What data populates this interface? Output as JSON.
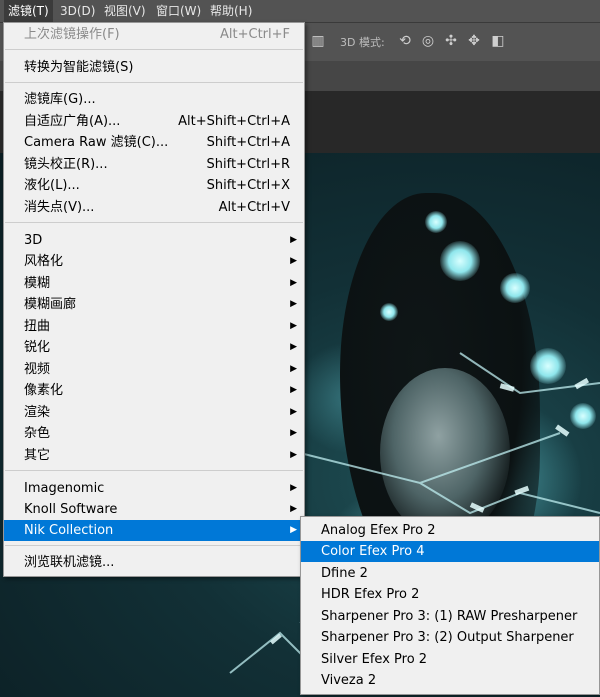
{
  "menubar": {
    "items": [
      {
        "label": "滤镜(T)",
        "active": true
      },
      {
        "label": "3D(D)",
        "active": false
      },
      {
        "label": "视图(V)",
        "active": false
      },
      {
        "label": "窗口(W)",
        "active": false
      },
      {
        "label": "帮助(H)",
        "active": false
      }
    ]
  },
  "options_bar": {
    "mode_label": "3D 模式:",
    "icons": [
      "rotate-3d-icon",
      "roll-3d-icon",
      "drag-3d-icon",
      "slide-3d-icon",
      "camera-3d-icon"
    ]
  },
  "filter_menu": {
    "items": [
      {
        "label": "上次滤镜操作(F)",
        "shortcut": "Alt+Ctrl+F",
        "disabled": true
      },
      {
        "label": "转换为智能滤镜(S)",
        "shortcut": ""
      },
      {
        "label": "滤镜库(G)...",
        "shortcut": ""
      },
      {
        "label": "自适应广角(A)...",
        "shortcut": "Alt+Shift+Ctrl+A"
      },
      {
        "label": "Camera Raw 滤镜(C)...",
        "shortcut": "Shift+Ctrl+A"
      },
      {
        "label": "镜头校正(R)...",
        "shortcut": "Shift+Ctrl+R"
      },
      {
        "label": "液化(L)...",
        "shortcut": "Shift+Ctrl+X"
      },
      {
        "label": "消失点(V)...",
        "shortcut": "Alt+Ctrl+V"
      },
      {
        "label": "3D",
        "submenu": true
      },
      {
        "label": "风格化",
        "submenu": true
      },
      {
        "label": "模糊",
        "submenu": true
      },
      {
        "label": "模糊画廊",
        "submenu": true
      },
      {
        "label": "扭曲",
        "submenu": true
      },
      {
        "label": "锐化",
        "submenu": true
      },
      {
        "label": "视频",
        "submenu": true
      },
      {
        "label": "像素化",
        "submenu": true
      },
      {
        "label": "渲染",
        "submenu": true
      },
      {
        "label": "杂色",
        "submenu": true
      },
      {
        "label": "其它",
        "submenu": true
      },
      {
        "label": "Imagenomic",
        "submenu": true
      },
      {
        "label": "Knoll Software",
        "submenu": true
      },
      {
        "label": "Nik Collection",
        "submenu": true,
        "highlighted": true
      },
      {
        "label": "浏览联机滤镜...",
        "shortcut": ""
      }
    ]
  },
  "nik_submenu": {
    "items": [
      {
        "label": "Analog Efex Pro 2"
      },
      {
        "label": "Color Efex Pro 4",
        "highlighted": true
      },
      {
        "label": "Dfine 2"
      },
      {
        "label": "HDR Efex Pro 2"
      },
      {
        "label": "Sharpener Pro 3: (1) RAW Presharpener"
      },
      {
        "label": "Sharpener Pro 3: (2) Output Sharpener"
      },
      {
        "label": "Silver Efex Pro 2"
      },
      {
        "label": "Viveza 2"
      }
    ]
  },
  "colors": {
    "highlight": "#0078d7",
    "menu_bg": "#f0f0f0",
    "menubar_bg": "#535353"
  }
}
